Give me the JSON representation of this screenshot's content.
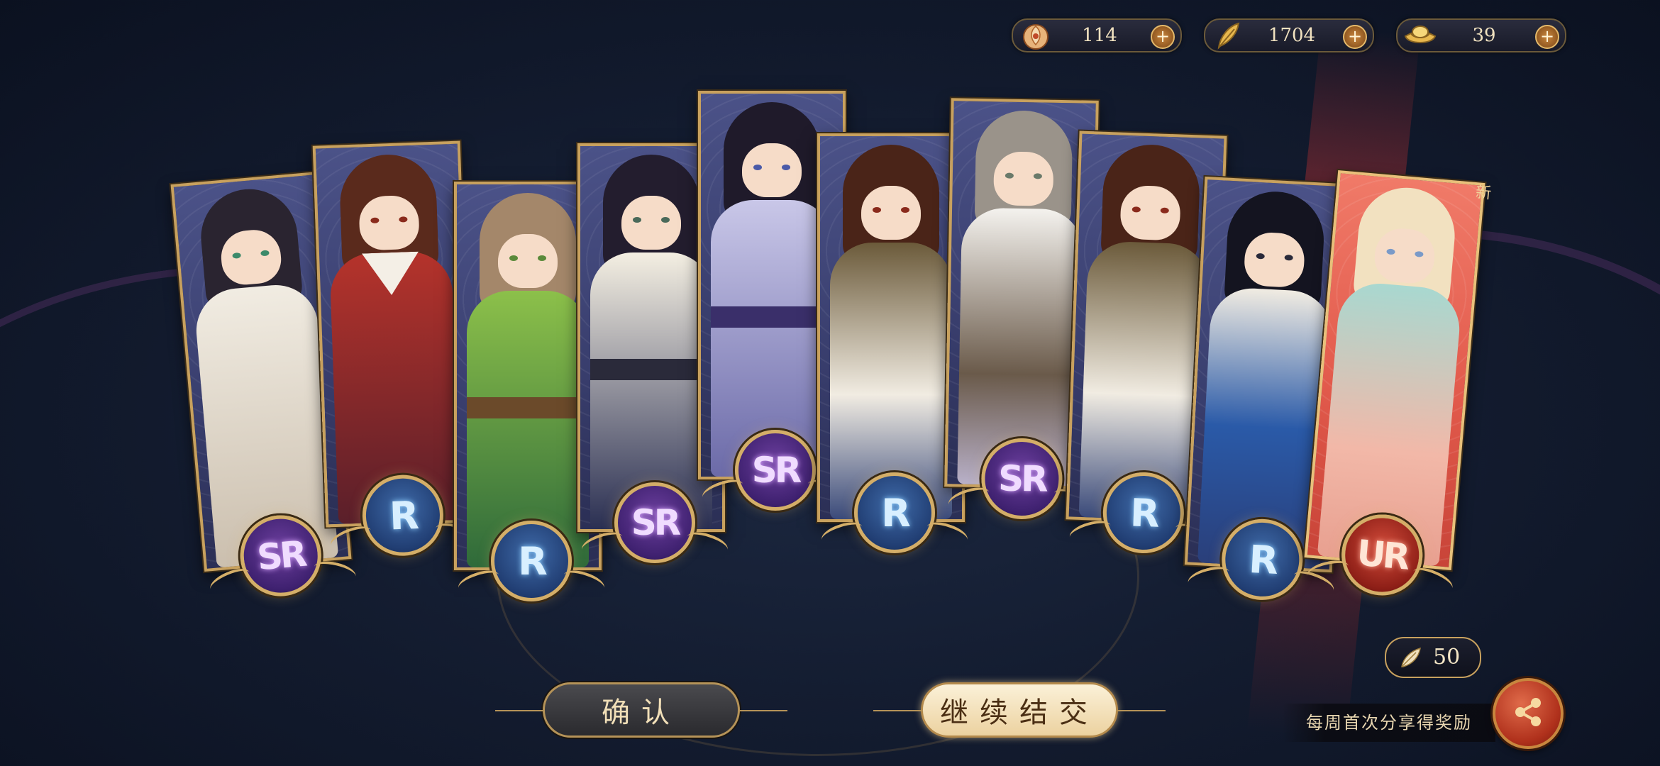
{
  "currencies": [
    {
      "icon": "peach-blossom-token-icon",
      "value": "114"
    },
    {
      "icon": "feather-icon",
      "value": "1704"
    },
    {
      "icon": "gold-ingot-icon",
      "value": "39"
    }
  ],
  "cards": [
    {
      "rarity": "SR",
      "label": "SR"
    },
    {
      "rarity": "R",
      "label": "R"
    },
    {
      "rarity": "R",
      "label": "R"
    },
    {
      "rarity": "SR",
      "label": "SR"
    },
    {
      "rarity": "SR",
      "label": "SR"
    },
    {
      "rarity": "R",
      "label": "R"
    },
    {
      "rarity": "SR",
      "label": "SR"
    },
    {
      "rarity": "R",
      "label": "R"
    },
    {
      "rarity": "R",
      "label": "R"
    },
    {
      "rarity": "UR",
      "label": "UR",
      "new_tag": "新"
    }
  ],
  "buttons": {
    "confirm": "确认",
    "continue": "继续结交"
  },
  "share": {
    "cost": "50",
    "cost_icon": "feather-icon",
    "reward_text": "每周首次分享得奖励",
    "icon": "share-icon"
  },
  "colors": {
    "gold_trim": "#c8a15e",
    "r_badge": "#213e73",
    "sr_badge": "#3f2170",
    "ur_badge": "#8e1f17"
  }
}
